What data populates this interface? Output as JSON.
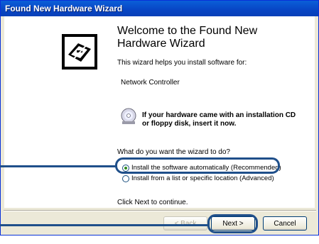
{
  "window": {
    "title": "Found New Hardware Wizard"
  },
  "content": {
    "heading_line1": "Welcome to the Found New",
    "heading_line2": "Hardware Wizard",
    "intro": "This wizard helps you install software for:",
    "device_name": "Network Controller",
    "cd_notice_line1": "If your hardware came with an installation CD",
    "cd_notice_line2": "or floppy disk, insert it now.",
    "question": "What do you want the wizard to do?",
    "options": [
      {
        "label": "Install the software automatically (Recommended)",
        "selected": true
      },
      {
        "label": "Install from a list or specific location (Advanced)",
        "selected": false
      }
    ],
    "continue_hint": "Click Next to continue."
  },
  "buttons": {
    "back": "< Back",
    "next": "Next >",
    "cancel": "Cancel"
  },
  "icons": {
    "wizard": "hardware-wizard-icon",
    "cd": "cd-disk-icon"
  },
  "colors": {
    "titlebar": "#0845c4",
    "highlight": "#1f4f8a",
    "window_bg": "#ece9d8"
  }
}
